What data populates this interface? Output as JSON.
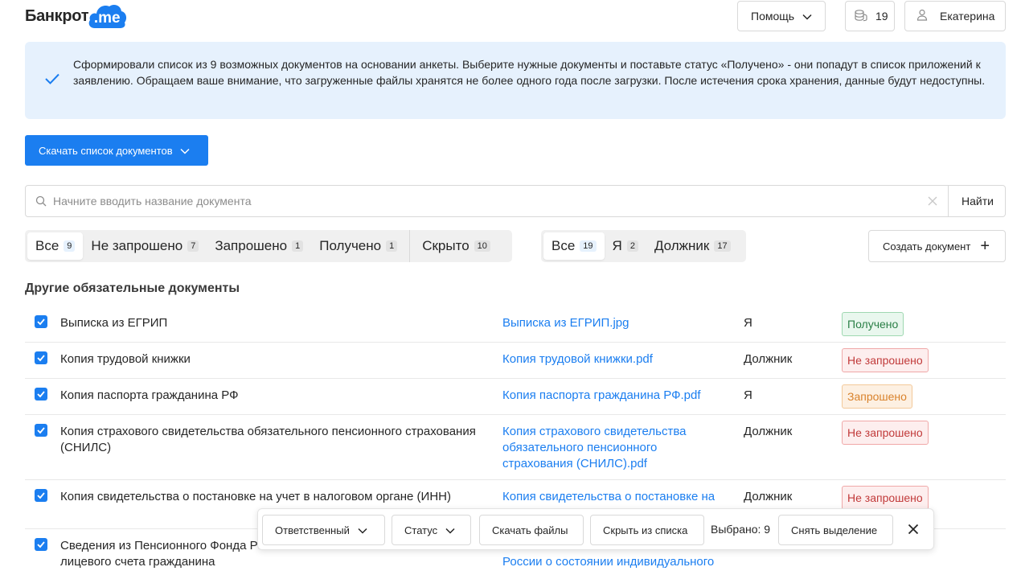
{
  "header": {
    "logo_text": "Банкрот",
    "logo_suffix": ".me",
    "help_label": "Помощь",
    "coins_count": "19",
    "user_name": "Екатерина"
  },
  "alert": {
    "text": "Сформировали список из 9 возможных документов на основании анкеты. Выберите нужные документы и поставьте статус «Получено» - они попадут в список приложений к заявлению. Обращаем ваше внимание, что загруженные файлы хранятся не более одного года после загрузки. После истечения срока хранения, данные будут недоступны."
  },
  "download_button": "Скачать список документов",
  "search": {
    "placeholder": "Начните вводить название документа",
    "button": "Найти"
  },
  "status_tabs": [
    {
      "label": "Все",
      "count": "9"
    },
    {
      "label": "Не запрошено",
      "count": "7"
    },
    {
      "label": "Запрошено",
      "count": "1"
    },
    {
      "label": "Получено",
      "count": "1"
    },
    {
      "label": "Скрыто",
      "count": "10"
    }
  ],
  "resp_tabs": [
    {
      "label": "Все",
      "count": "19"
    },
    {
      "label": "Я",
      "count": "2"
    },
    {
      "label": "Должник",
      "count": "17"
    }
  ],
  "create_button": "Создать документ",
  "section_title": "Другие обязательные документы",
  "documents": [
    {
      "name": "Выписка из ЕГРИП",
      "file": "Выписка из ЕГРИП.jpg",
      "responsible": "Я",
      "status": "Получено"
    },
    {
      "name": "Копия трудовой книжки",
      "file": "Копия трудовой книжки.pdf",
      "responsible": "Должник",
      "status": "Не запрошено"
    },
    {
      "name": "Копия паспорта гражданина РФ",
      "file": "Копия паспорта гражданина РФ.pdf",
      "responsible": "Я",
      "status": "Запрошено"
    },
    {
      "name": "Копия страхового свидетельства обязательного пенсионного страхования (СНИЛС)",
      "file": "Копия страхового свидетельства обязательного пенсионного страхования (СНИЛС).pdf",
      "responsible": "Должник",
      "status": "Не запрошено"
    },
    {
      "name": "Копия свидетельства о постановке на учет в налоговом органе (ИНН)",
      "file": "Копия свидетельства о постановке на",
      "responsible": "Должник",
      "status": "Не запрошено"
    },
    {
      "name": "Сведения из Пенсионного Фонда Ро",
      "name_line2": "лицевого счета гражданина",
      "file_line2": "России о состоянии индивидуального"
    }
  ],
  "action_bar": {
    "responsible": "Ответственный",
    "status": "Статус",
    "download_files": "Скачать файлы",
    "hide_from_list": "Скрыть из списка",
    "selected": "Выбрано: 9",
    "deselect": "Снять выделение"
  }
}
